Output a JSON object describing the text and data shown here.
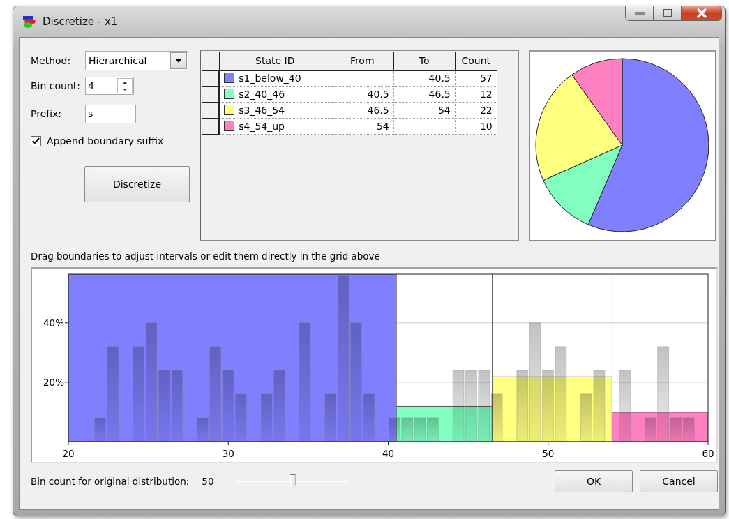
{
  "window": {
    "title": "Discretize - x1"
  },
  "method": {
    "label": "Method:",
    "value": "Hierarchical"
  },
  "bin_count": {
    "label": "Bin count:",
    "value": "4"
  },
  "prefix": {
    "label": "Prefix:",
    "value": "s"
  },
  "append_suffix": {
    "label": "Append boundary suffix",
    "checked": true
  },
  "discretize_button": "Discretize",
  "grid": {
    "columns": [
      "State ID",
      "From",
      "To",
      "Count"
    ],
    "rows": [
      {
        "state_id": "s1_below_40",
        "to": "40.5",
        "count": "57",
        "color": "#8080ff"
      },
      {
        "state_id": "s2_40_46",
        "from": "40.5",
        "to": "46.5",
        "count": "12",
        "color": "#80ffc0"
      },
      {
        "state_id": "s3_46_54",
        "from": "46.5",
        "to": "54",
        "count": "22",
        "color": "#ffff80"
      },
      {
        "state_id": "s4_54_up",
        "from": "54",
        "count": "10",
        "color": "#ff80c0"
      }
    ]
  },
  "hint": "Drag boundaries to adjust intervals or edit them directly in the grid above",
  "histogram": {
    "chart_data": {
      "type": "bar",
      "xlim": [
        20,
        60
      ],
      "ylim": [
        0,
        56.4
      ],
      "xticks": [
        20,
        30,
        40,
        50,
        60
      ],
      "yticks": [
        {
          "value": 20,
          "label": "20%"
        },
        {
          "value": 40,
          "label": "40%"
        }
      ],
      "x": [
        22,
        22.8,
        24.4,
        25.2,
        26,
        26.8,
        28.4,
        29.2,
        30,
        30.8,
        32.4,
        33.2,
        34.8,
        36.4,
        37.2,
        38,
        38.8,
        40.4,
        41.2,
        42,
        42.8,
        44.4,
        45.2,
        46,
        46.8,
        48.4,
        49.2,
        50,
        50.8,
        52.4,
        53.2,
        54.8,
        56.4,
        57.2,
        58,
        58.8
      ],
      "series": [
        {
          "color": "#808080",
          "values": [
            8,
            32,
            32,
            40,
            24,
            24,
            8,
            32,
            24,
            16,
            16,
            24,
            40,
            16,
            56,
            40,
            16,
            8,
            8,
            8,
            8,
            24,
            24,
            24,
            16,
            24,
            40,
            24,
            32,
            16,
            24,
            24,
            8,
            32,
            8,
            8
          ]
        }
      ]
    }
  },
  "original_bins": {
    "label": "Bin count for original distribution:",
    "value": "50",
    "level": 0.5
  },
  "buttons": [
    "OK",
    "Cancel"
  ]
}
